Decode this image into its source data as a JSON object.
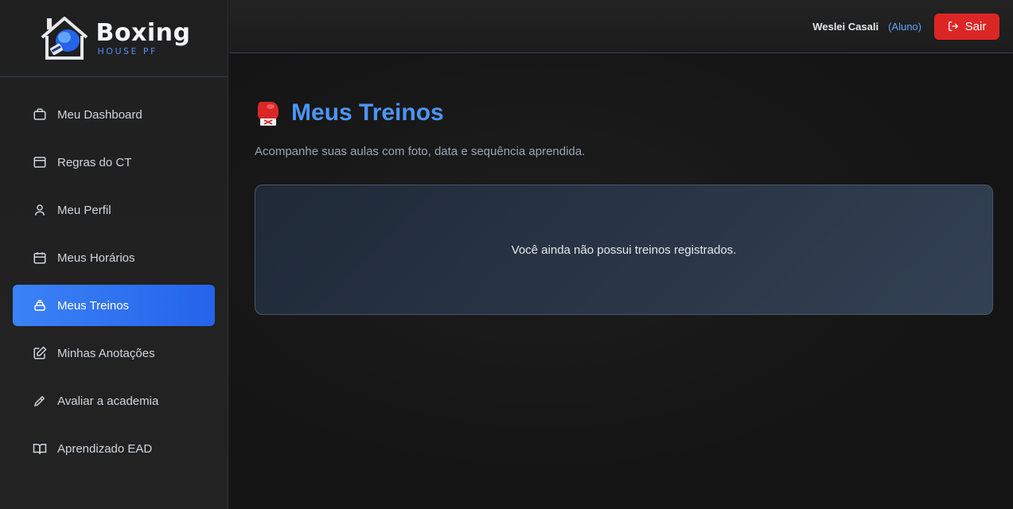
{
  "brand": {
    "name": "Boxing",
    "tagline": "HOUSE PF"
  },
  "sidebar": {
    "items": [
      {
        "label": "Meu Dashboard",
        "icon": "briefcase-icon"
      },
      {
        "label": "Regras do CT",
        "icon": "window-icon"
      },
      {
        "label": "Meu Perfil",
        "icon": "user-icon"
      },
      {
        "label": "Meus Horários",
        "icon": "calendar-icon"
      },
      {
        "label": "Meus Treinos",
        "icon": "stack-icon",
        "active": true
      },
      {
        "label": "Minhas Anotações",
        "icon": "edit-icon"
      },
      {
        "label": "Avaliar a academia",
        "icon": "pen-icon"
      },
      {
        "label": "Aprendizado EAD",
        "icon": "book-icon"
      }
    ]
  },
  "header": {
    "user_name": "Weslei Casali",
    "user_role": "(Aluno)",
    "logout_label": "Sair"
  },
  "main": {
    "title": "Meus Treinos",
    "title_icon": "boxing-glove-icon",
    "subtitle": "Acompanhe suas aulas com foto, data e sequência aprendida.",
    "empty_message": "Você ainda não possui treinos registrados."
  },
  "colors": {
    "accent": "#3b82f6",
    "title": "#4b95f7",
    "danger": "#dc2626",
    "role": "#60a5fa"
  }
}
